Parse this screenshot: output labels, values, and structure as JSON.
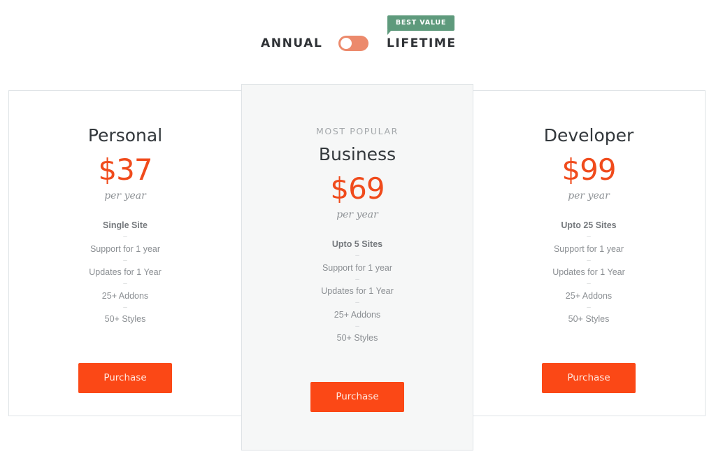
{
  "billing_toggle": {
    "annual_label": "ANNUAL",
    "lifetime_label": "LIFETIME",
    "badge_label": "BEST VALUE",
    "selected": "annual",
    "switch_color": "#ec8a6c",
    "badge_color": "#5e9a7c"
  },
  "accent_color": "#f04b1c",
  "button_color": "#fb4816",
  "plans": [
    {
      "name": "Personal",
      "ribbon": "",
      "price": "$37",
      "period": "per year",
      "features": [
        "Single Site",
        "Support for 1 year",
        "Updates for 1 Year",
        "25+ Addons",
        "50+ Styles"
      ],
      "separator": "–",
      "button_label": "Purchase"
    },
    {
      "name": "Business",
      "ribbon": "MOST POPULAR",
      "price": "$69",
      "period": "per year",
      "features": [
        "Upto 5 Sites",
        "Support for 1 year",
        "Updates for 1 Year",
        "25+ Addons",
        "50+ Styles"
      ],
      "separator": "–",
      "button_label": "Purchase"
    },
    {
      "name": "Developer",
      "ribbon": "",
      "price": "$99",
      "period": "per year",
      "features": [
        "Upto 25 Sites",
        "Support for 1 year",
        "Updates for 1 Year",
        "25+ Addons",
        "50+ Styles"
      ],
      "separator": "–",
      "button_label": "Purchase"
    }
  ]
}
